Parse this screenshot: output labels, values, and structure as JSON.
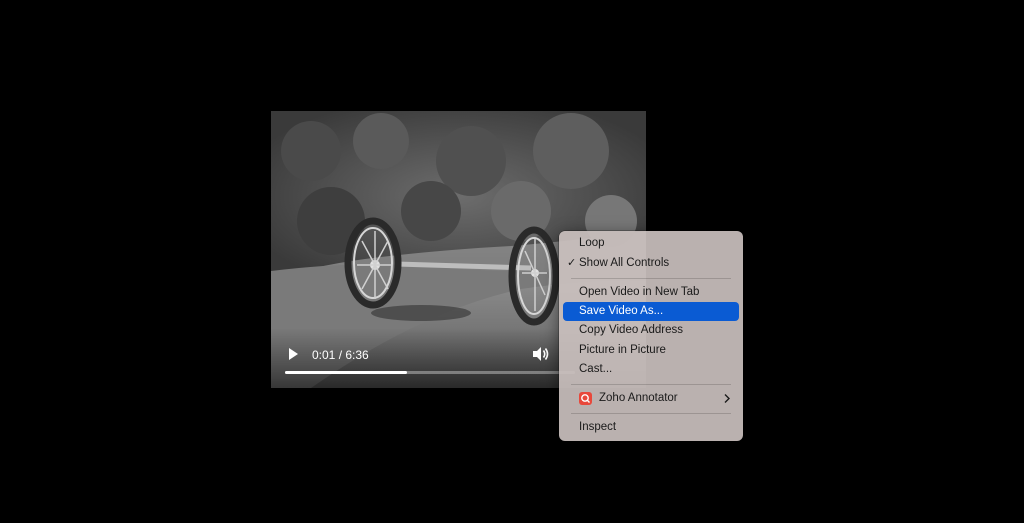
{
  "player": {
    "current_time": "0:01",
    "separator": " / ",
    "duration": "6:36",
    "progress_fraction": 0.42
  },
  "context_menu": {
    "items": [
      {
        "label": "Loop"
      },
      {
        "label": "Show All Controls",
        "checked": true,
        "check_glyph": "✓"
      },
      {
        "label": "Open Video in New Tab"
      },
      {
        "label": "Save Video As...",
        "highlighted": true
      },
      {
        "label": "Copy Video Address"
      },
      {
        "label": "Picture in Picture"
      },
      {
        "label": "Cast..."
      },
      {
        "label": "Zoho Annotator",
        "has_submenu": true,
        "icon": "zoho-annotator-icon"
      },
      {
        "label": "Inspect"
      }
    ]
  },
  "colors": {
    "highlight": "#0a5bd3",
    "menu_background": "#cac0be",
    "page_background": "#000000"
  }
}
